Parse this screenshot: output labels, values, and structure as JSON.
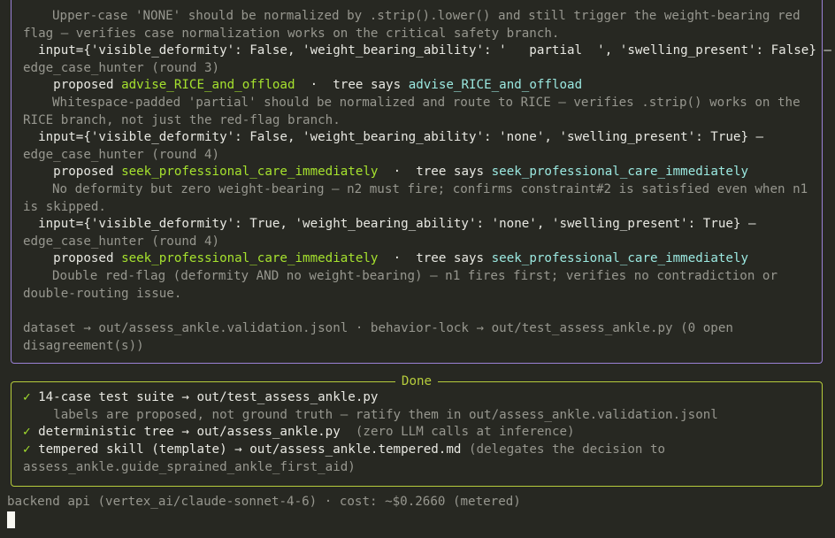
{
  "cases": [
    {
      "note": "Upper-case 'NONE' should be normalized by .strip().lower() and still trigger the weight-bearing red flag — verifies case normalization works on the critical safety branch."
    },
    {
      "input": "input={'visible_deformity': False, 'weight_bearing_ability': '   partial  ', 'swelling_present': False} —",
      "hunter": "edge_case_hunter (round 3)",
      "proposed_label": "proposed",
      "proposed_value": "advise_RICE_and_offload",
      "sep": "·",
      "tree_label": "tree says",
      "tree_value": "advise_RICE_and_offload",
      "note": "Whitespace-padded 'partial' should be normalized and route to RICE — verifies .strip() works on the RICE branch, not just the red-flag branch."
    },
    {
      "input": "input={'visible_deformity': False, 'weight_bearing_ability': 'none', 'swelling_present': True} —",
      "hunter": "edge_case_hunter (round 4)",
      "proposed_label": "proposed",
      "proposed_value": "seek_professional_care_immediately",
      "sep": "·",
      "tree_label": "tree says",
      "tree_value": "seek_professional_care_immediately",
      "note": "No deformity but zero weight-bearing — n2 must fire; confirms constraint#2 is satisfied even when n1 is skipped."
    },
    {
      "input": "input={'visible_deformity': True, 'weight_bearing_ability': 'none', 'swelling_present': True} —",
      "hunter": "edge_case_hunter (round 4)",
      "proposed_label": "proposed",
      "proposed_value": "seek_professional_care_immediately",
      "sep": "·",
      "tree_label": "tree says",
      "tree_value": "seek_professional_care_immediately",
      "note": "Double red-flag (deformity AND no weight-bearing) — n1 fires first; verifies no contradiction or double-routing issue."
    }
  ],
  "dataset_line": "dataset → out/assess_ankle.validation.jsonl · behavior-lock → out/test_assess_ankle.py (0 open disagreement(s))",
  "done": {
    "title": "Done",
    "check": "✓",
    "item1": "14-case test suite → out/test_assess_ankle.py",
    "item1_note": "labels are proposed, not ground truth — ratify them in out/assess_ankle.validation.jsonl",
    "item2": "deterministic tree → out/assess_ankle.py",
    "item2_note": "(zero LLM calls at inference)",
    "item3": "tempered skill (template) → out/assess_ankle.tempered.md",
    "item3_note": "(delegates the decision to assess_ankle.guide_sprained_ankle_first_aid)"
  },
  "status_line": "backend api (vertex_ai/claude-sonnet-4-6) · cost: ~$0.2660 (metered)",
  "colors": {
    "background": "#272822",
    "frame_purple": "#9a82d6",
    "frame_green": "#b6cc3c",
    "value_green": "#a6e22e",
    "value_cyan": "#9be8e0",
    "dim_text": "#97978f"
  }
}
